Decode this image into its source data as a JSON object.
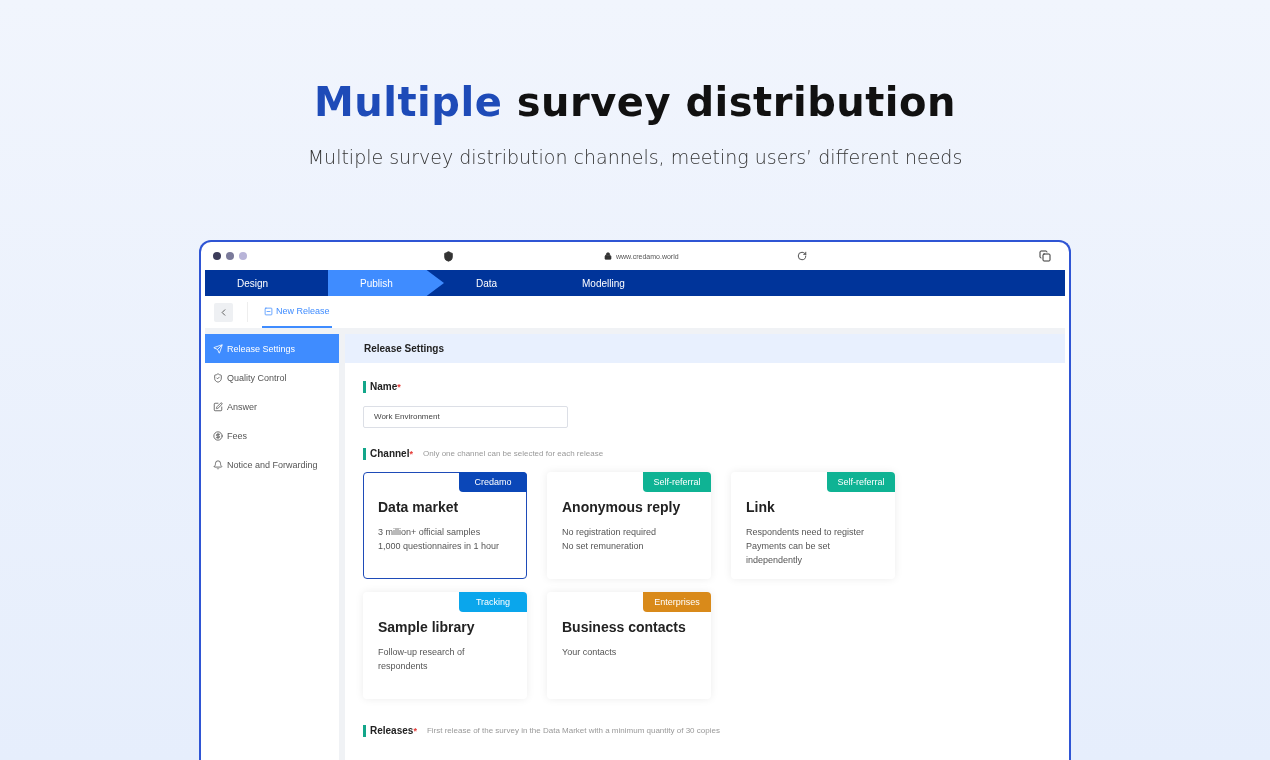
{
  "heading": {
    "accent": "Multiple",
    "rest": "survey distribution",
    "subtitle": "Multiple survey distribution channels, meeting users’ different needs"
  },
  "browser": {
    "url": "www.credamo.world"
  },
  "nav_tabs": [
    {
      "label": "Design",
      "selected": false
    },
    {
      "label": "Publish",
      "selected": true
    },
    {
      "label": "Data",
      "selected": false
    },
    {
      "label": "Modelling",
      "selected": false
    }
  ],
  "sub_tabs": [
    {
      "label": "New Release",
      "selected": true
    }
  ],
  "sidebar": {
    "items": [
      {
        "label": "Release Settings",
        "selected": true
      },
      {
        "label": "Quality Control",
        "selected": false
      },
      {
        "label": "Answer",
        "selected": false
      },
      {
        "label": "Fees",
        "selected": false
      },
      {
        "label": "Notice and Forwarding",
        "selected": false
      }
    ]
  },
  "panel": {
    "title": "Release Settings",
    "name_field": {
      "label": "Name",
      "required_mark": "*",
      "value": "Work Environment"
    },
    "channel": {
      "label": "Channel",
      "required_mark": "*",
      "hint": "Only one channel can be selected for each release",
      "cards": [
        {
          "title": "Data market",
          "lines": [
            "3 million+ official samples",
            "1,000 questionnaires in 1 hour"
          ],
          "badge": "Credamo",
          "color": "#0b47b8",
          "selected": true
        },
        {
          "title": "Anonymous reply",
          "lines": [
            "No registration required",
            "No set remuneration"
          ],
          "badge": "Self-referral",
          "color": "#0fb394",
          "selected": false
        },
        {
          "title": "Link",
          "lines": [
            "Respondents need to register",
            "Payments can be set independently"
          ],
          "badge": "Self-referral",
          "color": "#0fb394",
          "selected": false
        },
        {
          "title": "Sample library",
          "lines": [
            "Follow-up research of respondents"
          ],
          "badge": "Tracking",
          "color": "#0aa6ec",
          "selected": false
        },
        {
          "title": "Business contacts",
          "lines": [
            "Your contacts"
          ],
          "badge": "Enterprises",
          "color": "#d98a1a",
          "selected": false
        }
      ]
    },
    "releases": {
      "label": "Releases",
      "required_mark": "*",
      "hint": "First release of the survey in the Data Market with a minimum quantity of 30 copies"
    }
  }
}
